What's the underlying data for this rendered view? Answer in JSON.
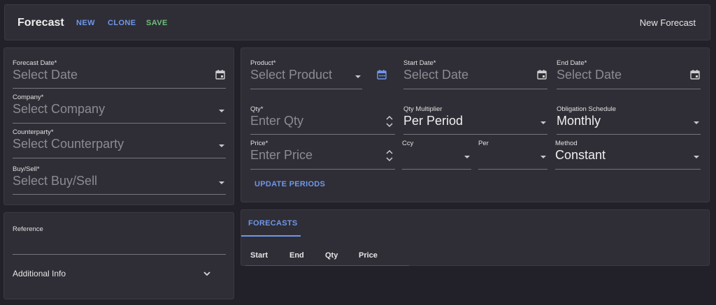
{
  "toolbar": {
    "title": "Forecast",
    "new_label": "NEW",
    "clone_label": "CLONE",
    "save_label": "SAVE",
    "right_title": "New Forecast"
  },
  "left_form": {
    "forecast_date": {
      "label": "Forecast Date*",
      "placeholder": "Select Date",
      "icon": "calendar-icon"
    },
    "company": {
      "label": "Company*",
      "placeholder": "Select Company",
      "icon": "dropdown-caret-icon"
    },
    "counterparty": {
      "label": "Counterparty*",
      "placeholder": "Select Counterparty",
      "icon": "dropdown-caret-icon"
    },
    "buy_sell": {
      "label": "Buy/Sell*",
      "placeholder": "Select Buy/Sell",
      "icon": "dropdown-caret-icon"
    }
  },
  "left_extra": {
    "reference": {
      "label": "Reference",
      "value": ""
    },
    "additional_info": {
      "label": "Additional Info",
      "icon": "chevron-down-icon"
    }
  },
  "right_form": {
    "product": {
      "label": "Product*",
      "placeholder": "Select Product",
      "icon": "calendar-icon"
    },
    "start_date": {
      "label": "Start Date*",
      "placeholder": "Select Date",
      "icon": "calendar-icon"
    },
    "end_date": {
      "label": "End Date*",
      "placeholder": "Select Date",
      "icon": "calendar-icon"
    },
    "qty": {
      "label": "Qty*",
      "placeholder": "Enter Qty",
      "icon": "spinner-icon"
    },
    "qty_multiplier": {
      "label": "Qty Multiplier",
      "value": "Per Period"
    },
    "obligation_schedule": {
      "label": "Obligation Schedule",
      "value": "Monthly"
    },
    "price": {
      "label": "Price*",
      "placeholder": "Enter Price",
      "icon": "spinner-icon"
    },
    "ccy": {
      "label": "Ccy",
      "value": ""
    },
    "per": {
      "label": "Per",
      "value": ""
    },
    "method": {
      "label": "Method",
      "value": "Constant"
    },
    "update_periods_label": "UPDATE PERIODS"
  },
  "forecasts": {
    "tab_label": "FORECASTS",
    "columns": [
      "Start",
      "End",
      "Qty",
      "Price"
    ]
  },
  "colors": {
    "background": "#222129",
    "panel": "#2f2e36",
    "accent_blue": "#6f97ea",
    "accent_green": "#6fbf7a"
  }
}
